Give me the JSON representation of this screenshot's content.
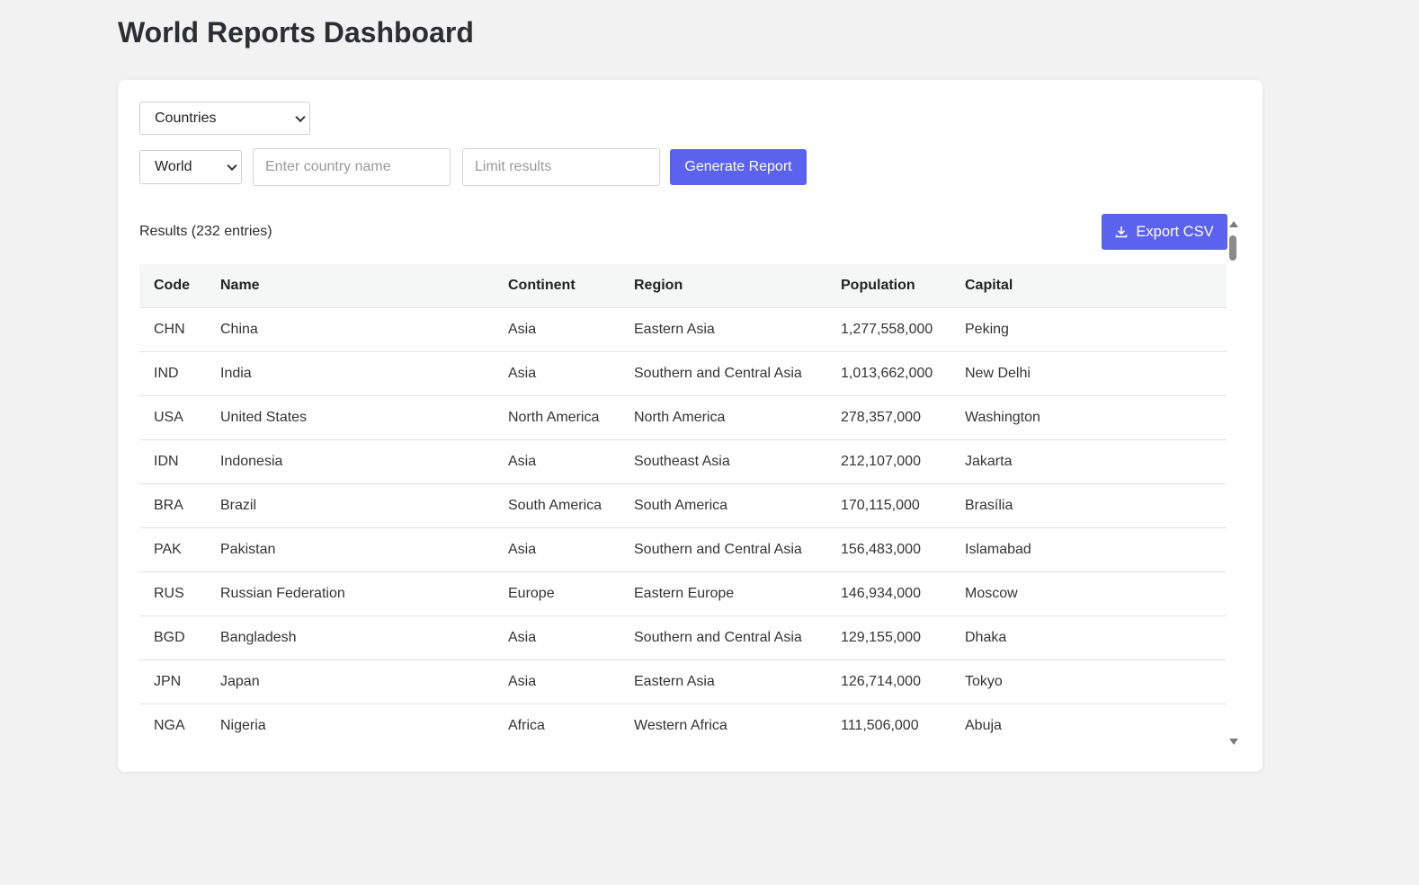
{
  "page": {
    "title": "World Reports Dashboard"
  },
  "controls": {
    "report_type": "Countries",
    "scope": "World",
    "country_placeholder": "Enter country name",
    "limit_placeholder": "Limit results",
    "generate_label": "Generate Report"
  },
  "results": {
    "label": "Results (232 entries)",
    "export_label": "Export CSV",
    "export_icon": "download-icon"
  },
  "table": {
    "headers": [
      "Code",
      "Name",
      "Continent",
      "Region",
      "Population",
      "Capital"
    ],
    "rows": [
      [
        "CHN",
        "China",
        "Asia",
        "Eastern Asia",
        "1,277,558,000",
        "Peking"
      ],
      [
        "IND",
        "India",
        "Asia",
        "Southern and Central Asia",
        "1,013,662,000",
        "New Delhi"
      ],
      [
        "USA",
        "United States",
        "North America",
        "North America",
        "278,357,000",
        "Washington"
      ],
      [
        "IDN",
        "Indonesia",
        "Asia",
        "Southeast Asia",
        "212,107,000",
        "Jakarta"
      ],
      [
        "BRA",
        "Brazil",
        "South America",
        "South America",
        "170,115,000",
        "Brasília"
      ],
      [
        "PAK",
        "Pakistan",
        "Asia",
        "Southern and Central Asia",
        "156,483,000",
        "Islamabad"
      ],
      [
        "RUS",
        "Russian Federation",
        "Europe",
        "Eastern Europe",
        "146,934,000",
        "Moscow"
      ],
      [
        "BGD",
        "Bangladesh",
        "Asia",
        "Southern and Central Asia",
        "129,155,000",
        "Dhaka"
      ],
      [
        "JPN",
        "Japan",
        "Asia",
        "Eastern Asia",
        "126,714,000",
        "Tokyo"
      ],
      [
        "NGA",
        "Nigeria",
        "Africa",
        "Western Africa",
        "111,506,000",
        "Abuja"
      ]
    ]
  },
  "colors": {
    "accent": "#5b62ee",
    "background": "#f2f2f2",
    "card": "#ffffff"
  }
}
